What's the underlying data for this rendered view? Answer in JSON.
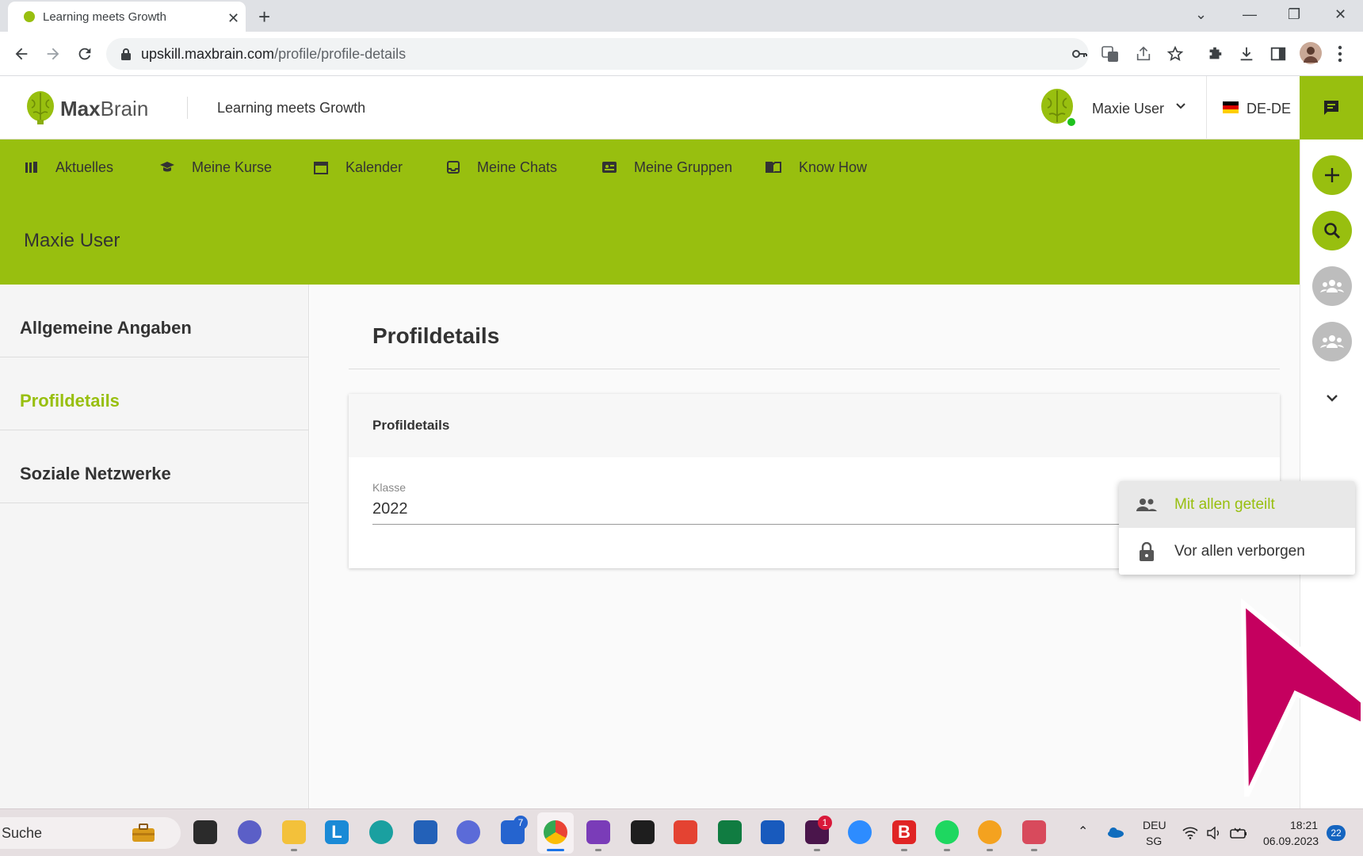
{
  "browser": {
    "tab_title": "Learning meets Growth",
    "url_host": "upskill.maxbrain.com",
    "url_path": "/profile/profile-details"
  },
  "header": {
    "logo_bold": "Max",
    "logo_light": "Brain",
    "tagline": "Learning meets Growth",
    "user_name": "Maxie User",
    "language": "DE-DE"
  },
  "nav": {
    "items": [
      {
        "label": "Aktuelles",
        "icon": "library-icon"
      },
      {
        "label": "Meine Kurse",
        "icon": "graduation-cap-icon"
      },
      {
        "label": "Kalender",
        "icon": "calendar-icon"
      },
      {
        "label": "Meine Chats",
        "icon": "inbox-icon"
      },
      {
        "label": "Meine Gruppen",
        "icon": "group-card-icon"
      },
      {
        "label": "Know How",
        "icon": "book-icon"
      }
    ]
  },
  "banner": {
    "title": "Maxie User"
  },
  "sidebar": {
    "items": [
      {
        "label": "Allgemeine Angaben"
      },
      {
        "label": "Profildetails"
      },
      {
        "label": "Soziale Netzwerke"
      }
    ],
    "active_index": 1
  },
  "main": {
    "title": "Profildetails",
    "card_title": "Profildetails",
    "field_label": "Klasse",
    "field_value": "2022"
  },
  "visibility_menu": {
    "options": [
      {
        "label": "Mit allen geteilt",
        "icon": "people-icon",
        "selected": true
      },
      {
        "label": "Vor allen verborgen",
        "icon": "lock-icon",
        "selected": false
      }
    ]
  },
  "taskbar": {
    "search_label": "Suche",
    "lang_top": "DEU",
    "lang_bottom": "SG",
    "time": "18:21",
    "date": "06.09.2023",
    "notification_count": "22",
    "todo_badge": "7",
    "slack_badge": "1"
  },
  "colors": {
    "brand_green": "#98bf0f",
    "cursor_magenta": "#c5005f"
  }
}
